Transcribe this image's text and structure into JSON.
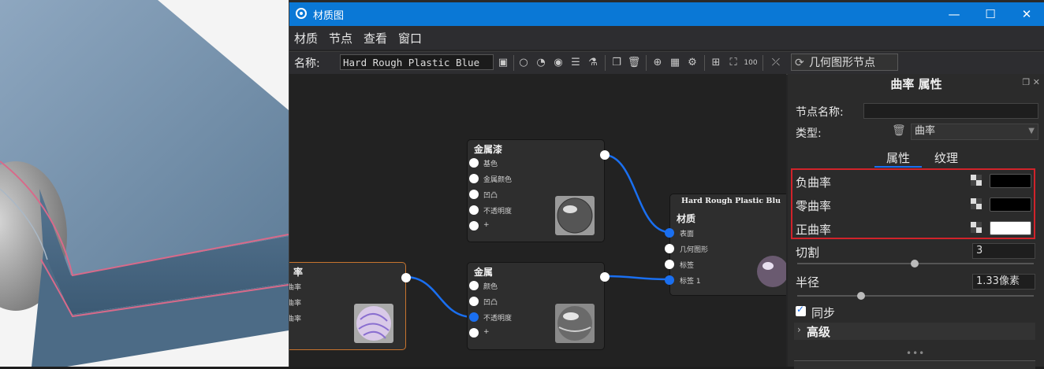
{
  "window": {
    "title": "材质图",
    "minimize": "—",
    "maximize": "☐",
    "close": "✕"
  },
  "menu": [
    "材质",
    "节点",
    "查看",
    "窗口"
  ],
  "toolbar": {
    "name_label": "名称:",
    "material_name": "Hard Rough Plastic Blue",
    "geometry_button": "几何图形节点"
  },
  "nodes": {
    "metallic_paint": {
      "title": "金属漆",
      "ports": [
        "基色",
        "金属颜色",
        "凹凸",
        "不透明度",
        "+"
      ]
    },
    "metal": {
      "title": "金属",
      "ports": [
        "颜色",
        "凹凸",
        "不透明度",
        "+"
      ]
    },
    "curvature": {
      "title": "率",
      "ports": [
        "曲率",
        "曲率",
        "曲率"
      ]
    },
    "material": {
      "header": "Hard Rough Plastic Blu",
      "title": "材质",
      "ports": [
        "表面",
        "几何图形",
        "标签",
        "标签 1"
      ]
    }
  },
  "panel": {
    "title": "曲率 属性",
    "node_name_label": "节点名称:",
    "node_name_value": "",
    "type_label": "类型:",
    "type_value": "曲率",
    "tabs": [
      "属性",
      "纹理"
    ],
    "rows": [
      {
        "label": "负曲率",
        "color": "#000000"
      },
      {
        "label": "零曲率",
        "color": "#000000"
      },
      {
        "label": "正曲率",
        "color": "#ffffff"
      }
    ],
    "cut_label": "切割",
    "cut_value": "3",
    "radius_label": "半径",
    "radius_value": "1.33像素",
    "sync_label": "同步",
    "advanced_label": "高级",
    "more": "•••"
  },
  "colors": {
    "accent": "#1a6ff0",
    "titlebar": "#0a78d6",
    "highlight": "#d1232a"
  }
}
